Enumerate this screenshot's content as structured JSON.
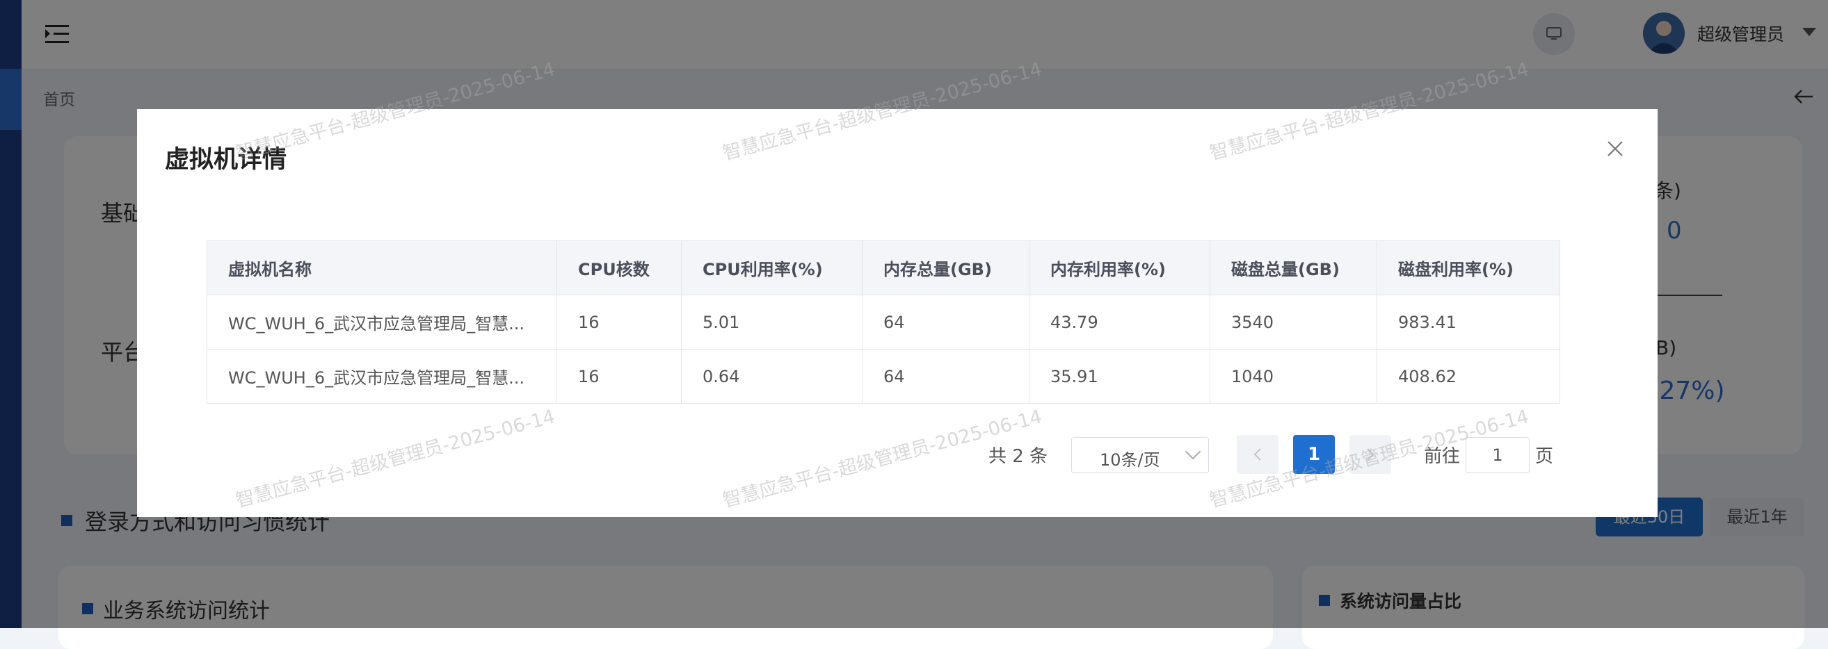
{
  "header": {
    "user_name": "超级管理员"
  },
  "breadcrumb": {
    "home": "首页"
  },
  "background": {
    "label_1": "基础",
    "label_2": "平台",
    "right_1": "条)",
    "right_2": "0",
    "right_3": "B)",
    "right_4": ".27%)",
    "section_title": "登录方式和访问习惯统计",
    "range_30d": "最近30日",
    "range_1y": "最近1年",
    "card_left_title": "业务系统访问统计",
    "card_right_title": "系统访问量占比"
  },
  "modal": {
    "title": "虚拟机详情",
    "columns": [
      "虚拟机名称",
      "CPU核数",
      "CPU利用率(%)",
      "内存总量(GB)",
      "内存利用率(%)",
      "磁盘总量(GB)",
      "磁盘利用率(%)"
    ],
    "rows": [
      [
        "WC_WUH_6_武汉市应急管理局_智慧...",
        "16",
        "5.01",
        "64",
        "43.79",
        "3540",
        "983.41"
      ],
      [
        "WC_WUH_6_武汉市应急管理局_智慧...",
        "16",
        "0.64",
        "64",
        "35.91",
        "1040",
        "408.62"
      ]
    ],
    "pager": {
      "total": "共 2 条",
      "page_size": "10条/页",
      "current_page": "1",
      "goto_label": "前往",
      "goto_value": "1",
      "page_suffix": "页"
    }
  },
  "watermark": "智慧应急平台-超级管理员-2025-06-14",
  "colors": {
    "primary": "#1f6fd0",
    "sidebar": "#1c3f86"
  }
}
